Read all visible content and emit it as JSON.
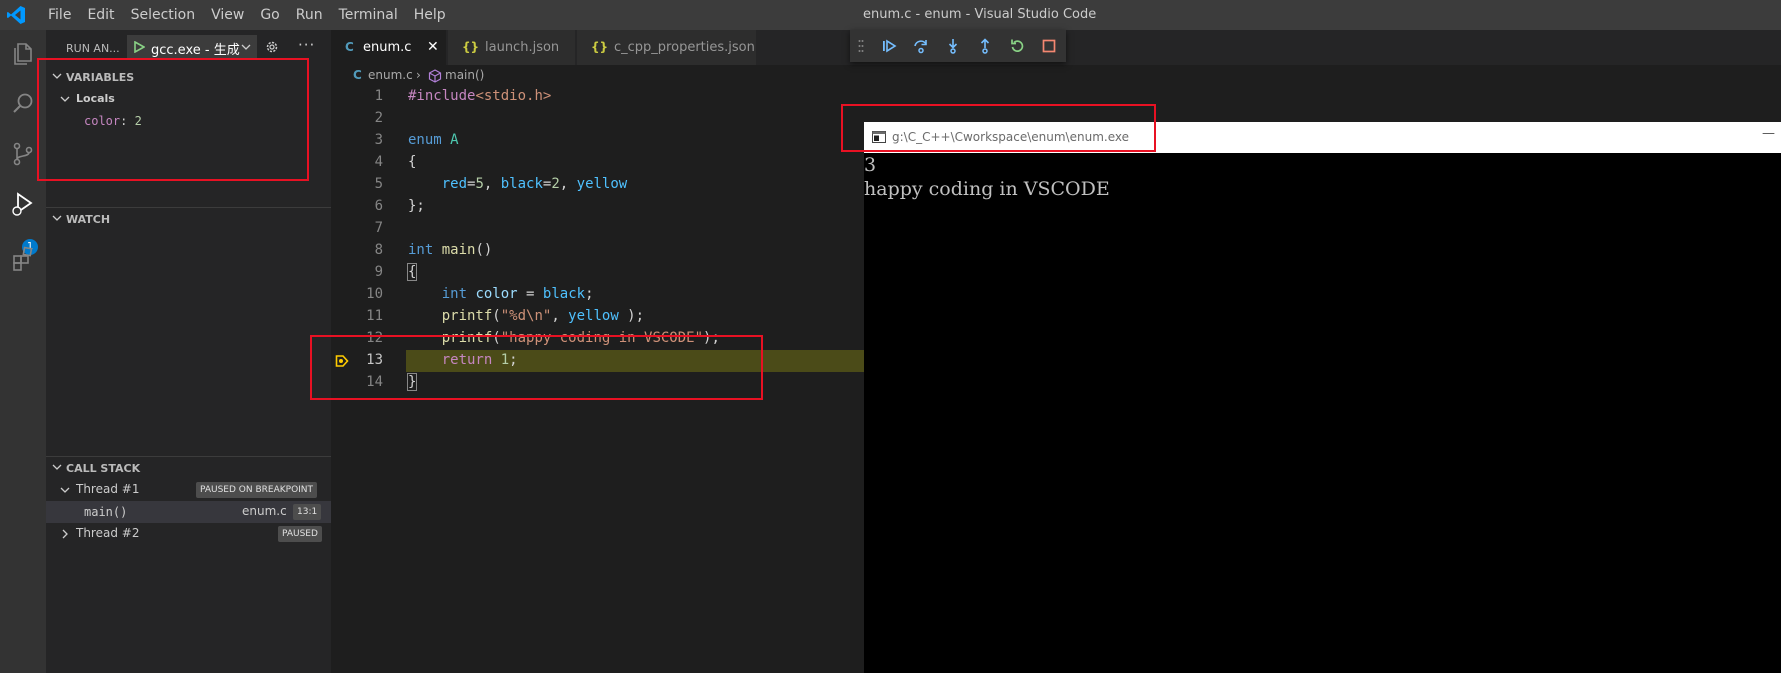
{
  "titlebar": {
    "menu": [
      "File",
      "Edit",
      "Selection",
      "View",
      "Go",
      "Run",
      "Terminal",
      "Help"
    ],
    "window_title": "enum.c - enum - Visual Studio Code"
  },
  "activity": {
    "badge": "1"
  },
  "sidebar": {
    "run_title": "RUN AN...",
    "run_config": "gcc.exe - 生成",
    "more": "···",
    "variables": {
      "title": "VARIABLES",
      "scope": "Locals",
      "items": [
        {
          "name": "color",
          "value": "2"
        }
      ]
    },
    "watch": {
      "title": "WATCH"
    },
    "callstack": {
      "title": "CALL STACK",
      "threads": [
        {
          "name": "Thread #1",
          "status": "PAUSED ON BREAKPOINT",
          "frames": [
            {
              "func": "main()",
              "file": "enum.c",
              "pos": "13:1"
            }
          ]
        },
        {
          "name": "Thread #2",
          "status": "PAUSED"
        }
      ]
    }
  },
  "tabs": [
    {
      "icon": "C",
      "name": "enum.c",
      "active": true
    },
    {
      "icon": "{}",
      "name": "launch.json"
    },
    {
      "icon": "{}",
      "name": "c_cpp_properties.json"
    }
  ],
  "breadcrumb": {
    "file": "enum.c",
    "symbol": "main()"
  },
  "code": {
    "line_numbers": [
      "1",
      "2",
      "3",
      "4",
      "5",
      "6",
      "7",
      "8",
      "9",
      "10",
      "11",
      "12",
      "13",
      "14"
    ],
    "tokens": {
      "l1_dir": "#include",
      "l1_hdr": "<stdio.h>",
      "l3_kw": "enum",
      "l3_name": "A",
      "l4": "{",
      "l5_indent": "    ",
      "l5_red": "red",
      "l5_eq1": "=",
      "l5_5": "5",
      "l5_c1": ", ",
      "l5_black": "black",
      "l5_eq2": "=",
      "l5_2": "2",
      "l5_c2": ", ",
      "l5_yellow": "yellow",
      "l6": "};",
      "l8_kw": "int",
      "l8_sp": " ",
      "l8_fn": "main",
      "l8_par": "()",
      "l9": "{",
      "l10_indent": "    ",
      "l10_kw": "int",
      "l10_sp": " ",
      "l10_var": "color",
      "l10_eq": " = ",
      "l10_black": "black",
      "l10_semi": ";",
      "l11_indent": "    ",
      "l11_fn": "printf",
      "l11_open": "(",
      "l11_str": "\"%d\\n\"",
      "l11_c": ", ",
      "l11_yellow": "yellow",
      "l11_close": " );",
      "l12_indent": "    ",
      "l12_fn": "printf",
      "l12_open": "(",
      "l12_str": "\"happy coding in VSCODE\"",
      "l12_close": ");",
      "l13_indent": "    ",
      "l13_kw": "return",
      "l13_sp": " ",
      "l13_num": "1",
      "l13_semi": ";",
      "l14": "}"
    }
  },
  "console": {
    "title": "g:\\C_C++\\Cworkspace\\enum\\enum.exe",
    "minimize": "—",
    "output": "3\nhappy coding in VSCODE"
  },
  "colors": {
    "accent": "#007acc",
    "highlight_red": "#e81123",
    "debug_line": "#4b4b18",
    "breakpoint_arrow": "#ffcc00"
  }
}
